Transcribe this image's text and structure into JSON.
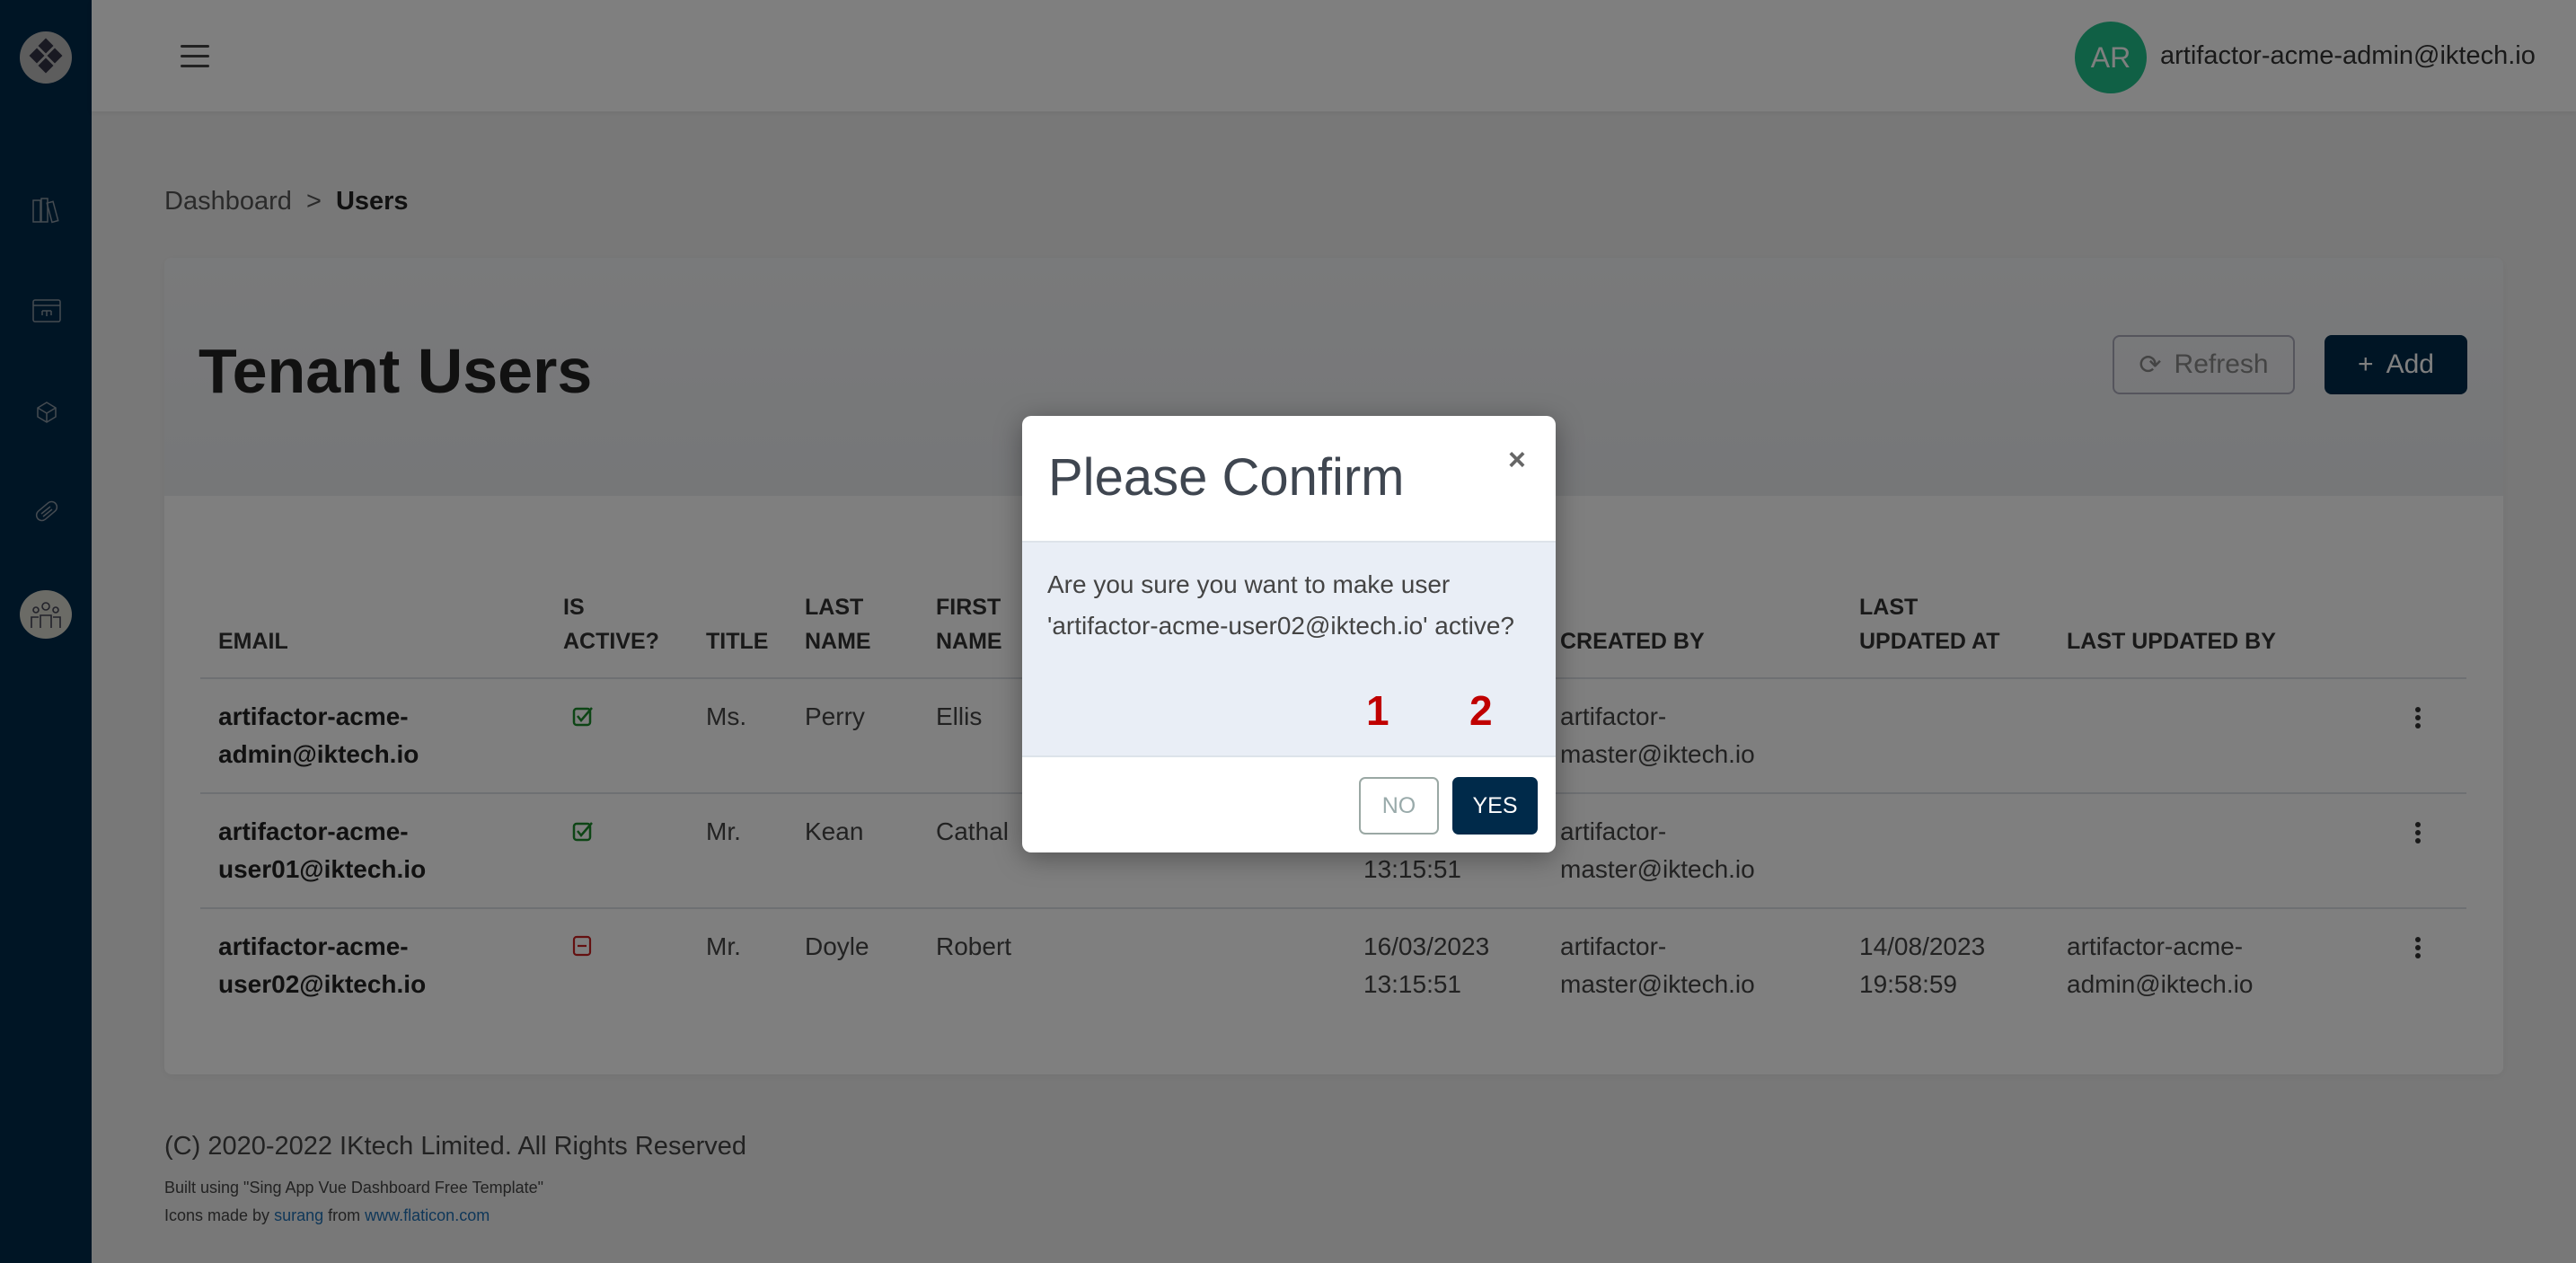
{
  "colors": {
    "sidebar": "#002a4a",
    "accent": "#002a4a",
    "avatar": "#21c08b",
    "active": "#1a8a2a",
    "inactive": "#c82020",
    "annotation": "#c00000"
  },
  "sidebar": {
    "items": [
      {
        "icon": "logo-icon"
      },
      {
        "icon": "books-icon"
      },
      {
        "icon": "workflow-window-icon"
      },
      {
        "icon": "network-cube-icon"
      },
      {
        "icon": "tag-icon"
      },
      {
        "icon": "users-group-icon",
        "active": true
      }
    ]
  },
  "header": {
    "avatar_initials": "AR",
    "user_email": "artifactor-acme-admin@iktech.io"
  },
  "breadcrumb": {
    "parent": "Dashboard",
    "separator": ">",
    "current": "Users"
  },
  "page": {
    "title": "Tenant Users",
    "refresh_label": "Refresh",
    "add_label": "Add"
  },
  "table": {
    "headers": [
      [
        "",
        "EMAIL"
      ],
      [
        "IS",
        "ACTIVE?"
      ],
      [
        "",
        "TITLE"
      ],
      [
        "LAST",
        "NAME"
      ],
      [
        "FIRST",
        "NAME"
      ],
      [
        "",
        "CREATED BY"
      ],
      [
        "LAST",
        "UPDATED AT"
      ],
      [
        "",
        "LAST UPDATED BY"
      ]
    ],
    "rows": [
      {
        "email": [
          "artifactor-acme-",
          "admin@iktech.io"
        ],
        "active": true,
        "title": "Ms.",
        "last_name": "Perry",
        "first_name": "Ellis",
        "created_at": [
          "",
          ""
        ],
        "created_by": [
          "artifactor-",
          "master@iktech.io"
        ],
        "updated_at": [
          "",
          ""
        ],
        "updated_by": [
          "",
          ""
        ]
      },
      {
        "email": [
          "artifactor-acme-",
          "user01@iktech.io"
        ],
        "active": true,
        "title": "Mr.",
        "last_name": "Kean",
        "first_name": "Cathal",
        "created_at": [
          "",
          "13:15:51"
        ],
        "created_by": [
          "artifactor-",
          "master@iktech.io"
        ],
        "updated_at": [
          "",
          ""
        ],
        "updated_by": [
          "",
          ""
        ]
      },
      {
        "email": [
          "artifactor-acme-",
          "user02@iktech.io"
        ],
        "active": false,
        "title": "Mr.",
        "last_name": "Doyle",
        "first_name": "Robert",
        "created_at": [
          "16/03/2023",
          "13:15:51"
        ],
        "created_by": [
          "artifactor-",
          "master@iktech.io"
        ],
        "updated_at": [
          "14/08/2023",
          "19:58:59"
        ],
        "updated_by": [
          "artifactor-acme-",
          "admin@iktech.io"
        ]
      }
    ]
  },
  "footer": {
    "copyright": "(C) 2020-2022 IKtech Limited. All Rights Reserved",
    "built": "Built using \"Sing App Vue Dashboard Free Template\"",
    "icons_prefix": "Icons made by",
    "icons_author": "surang",
    "icons_from": "from",
    "icons_site": "www.flaticon.com"
  },
  "modal": {
    "title": "Please Confirm",
    "close": "×",
    "message": "Are you sure you want to make user 'artifactor-acme-user02@iktech.io' active?",
    "no_label": "NO",
    "yes_label": "YES",
    "annotation_1": "1",
    "annotation_2": "2"
  }
}
